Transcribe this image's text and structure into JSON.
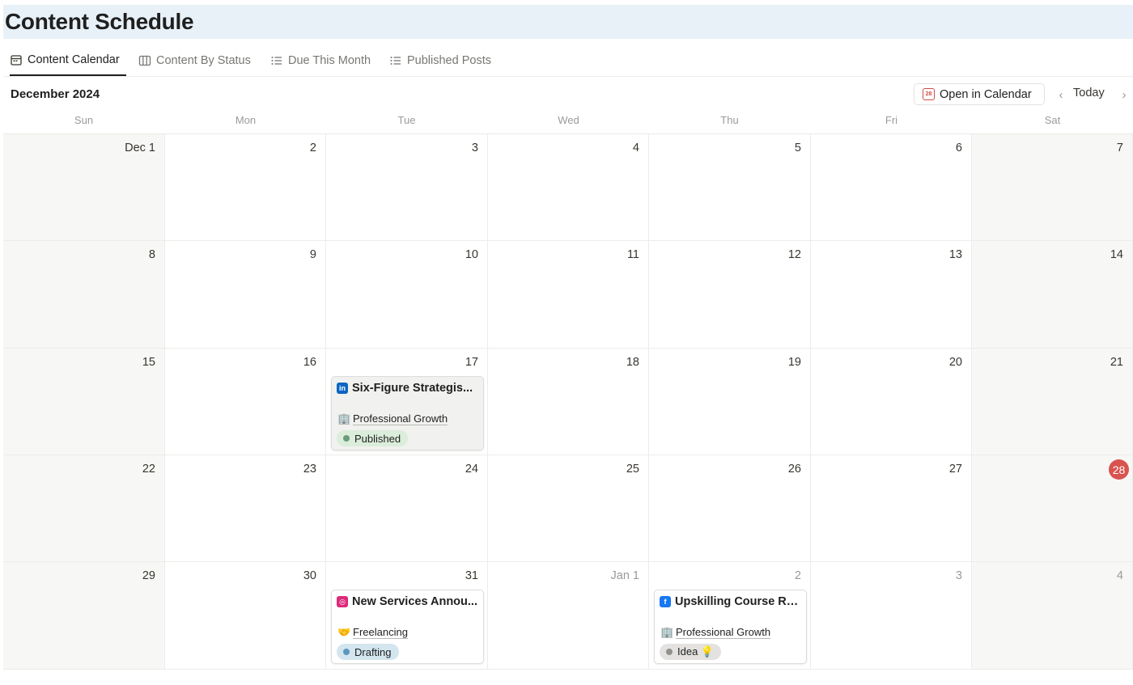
{
  "page": {
    "title": "Content Schedule"
  },
  "tabs": [
    {
      "label": "Content Calendar",
      "icon": "calendar-icon",
      "active": true
    },
    {
      "label": "Content By Status",
      "icon": "board-icon",
      "active": false
    },
    {
      "label": "Due This Month",
      "icon": "list-icon",
      "active": false
    },
    {
      "label": "Published Posts",
      "icon": "list-icon",
      "active": false
    }
  ],
  "calendar": {
    "month_label": "December 2024",
    "open_in_calendar": "Open in Calendar",
    "open_icon_text": "28",
    "today_label": "Today",
    "prev_icon": "‹",
    "next_icon": "›",
    "weekdays": [
      "Sun",
      "Mon",
      "Tue",
      "Wed",
      "Thu",
      "Fri",
      "Sat"
    ],
    "weeks": [
      [
        "Dec 1",
        "2",
        "3",
        "4",
        "5",
        "6",
        "7"
      ],
      [
        "8",
        "9",
        "10",
        "11",
        "12",
        "13",
        "14"
      ],
      [
        "15",
        "16",
        "17",
        "18",
        "19",
        "20",
        "21"
      ],
      [
        "22",
        "23",
        "24",
        "25",
        "26",
        "27",
        "28"
      ],
      [
        "29",
        "30",
        "31",
        "Jan 1",
        "2",
        "3",
        "4"
      ]
    ],
    "today": "28",
    "accent": "#d9534f"
  },
  "events": [
    {
      "title": "Six-Figure Strategis...",
      "platform_icon": "linkedin-icon",
      "platform_glyph": "in",
      "platform_color": "#0a66c2",
      "category_emoji": "🏢",
      "category": "Professional Growth",
      "status": "Published",
      "status_bg": "#dbeddb",
      "status_dot": "#6c9b7d",
      "card_style": "published"
    },
    {
      "title": "New Services Annou...",
      "platform_icon": "instagram-icon",
      "platform_glyph": "◎",
      "platform_color": "#dd2a7b",
      "category_emoji": "🤝",
      "category": "Freelancing",
      "status": "Drafting",
      "status_bg": "#d3e5ef",
      "status_dot": "#5b97bd",
      "card_style": "normal"
    },
    {
      "title": "Upskilling Course Re...",
      "platform_icon": "facebook-icon",
      "platform_glyph": "f",
      "platform_color": "#1877f2",
      "category_emoji": "🏢",
      "category": "Professional Growth",
      "status": "Idea 💡",
      "status_bg": "#e3e2e0",
      "status_dot": "#91918e",
      "card_style": "normal"
    }
  ]
}
